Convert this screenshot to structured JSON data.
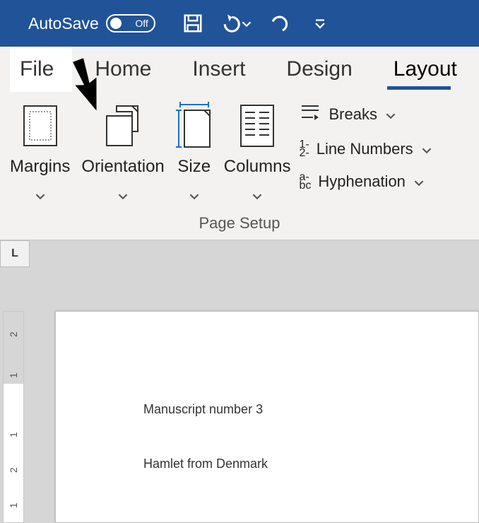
{
  "titlebar": {
    "autosave_label": "AutoSave",
    "autosave_state": "Off"
  },
  "tabs": {
    "file": "File",
    "home": "Home",
    "insert": "Insert",
    "design": "Design",
    "layout": "Layout"
  },
  "ribbon": {
    "margins": "Margins",
    "orientation": "Orientation",
    "size": "Size",
    "columns": "Columns",
    "breaks": "Breaks",
    "line_numbers": "Line Numbers",
    "hyphenation": "Hyphenation",
    "group_label": "Page Setup"
  },
  "ruler_corner": "L",
  "vruler_marks": {
    "a": "2",
    "b": "1",
    "c": "1",
    "d": "2",
    "e": "1"
  },
  "document": {
    "line1": "Manuscript number 3",
    "line2": "Hamlet from Denmark"
  }
}
